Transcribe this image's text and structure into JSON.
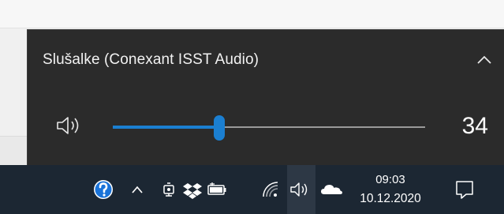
{
  "flyout": {
    "device_name": "Slušalke (Conexant ISST Audio)",
    "volume_value": "34",
    "volume_level": 0.34,
    "accent_color": "#1b7fd1",
    "icons": [
      "chevron-up-icon",
      "speaker-icon"
    ]
  },
  "taskbar": {
    "time": "09:03",
    "date": "10.12.2020",
    "tray_icons": [
      "help-icon",
      "show-hidden-icons-chevron",
      "meet-now-icon",
      "dropbox-icon",
      "battery-icon",
      "wifi-icon",
      "volume-icon",
      "onedrive-cloud-icon",
      "notifications-icon"
    ]
  }
}
